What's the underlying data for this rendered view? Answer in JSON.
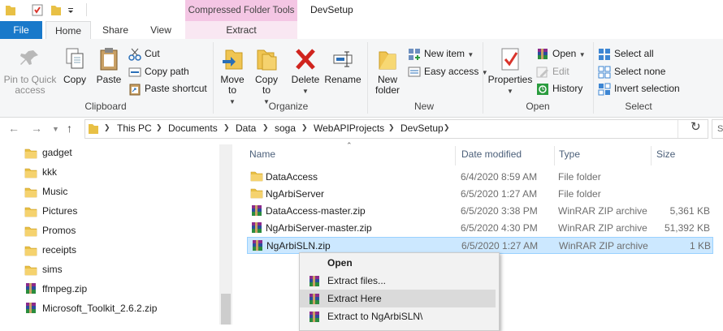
{
  "window": {
    "title": "DevSetup",
    "context_header": "Compressed Folder Tools"
  },
  "tabs": [
    {
      "label": "File"
    },
    {
      "label": "Home"
    },
    {
      "label": "Share"
    },
    {
      "label": "View"
    },
    {
      "label": "Extract"
    }
  ],
  "ribbon": {
    "clipboard": {
      "pin": "Pin to Quick access",
      "copy": "Copy",
      "paste": "Paste",
      "cut": "Cut",
      "copy_path": "Copy path",
      "paste_shortcut": "Paste shortcut",
      "label": "Clipboard"
    },
    "organize": {
      "move_to": "Move to",
      "copy_to": "Copy to",
      "delete": "Delete",
      "rename": "Rename",
      "label": "Organize"
    },
    "new": {
      "new_folder": "New folder",
      "new_item": "New item",
      "easy_access": "Easy access",
      "label": "New"
    },
    "open": {
      "properties": "Properties",
      "open": "Open",
      "edit": "Edit",
      "history": "History",
      "label": "Open"
    },
    "select": {
      "select_all": "Select all",
      "select_none": "Select none",
      "invert": "Invert selection",
      "label": "Select"
    }
  },
  "address": {
    "crumbs": [
      "This PC",
      "Documents",
      "Data",
      "soga",
      "WebAPIProjects",
      "DevSetup"
    ],
    "search_placeholder": "S"
  },
  "nav_pane": [
    {
      "label": "gadget",
      "icon": "folder-icon"
    },
    {
      "label": "kkk",
      "icon": "folder-icon"
    },
    {
      "label": "Music",
      "icon": "folder-icon"
    },
    {
      "label": "Pictures",
      "icon": "folder-icon"
    },
    {
      "label": "Promos",
      "icon": "folder-icon"
    },
    {
      "label": "receipts",
      "icon": "folder-icon"
    },
    {
      "label": "sims",
      "icon": "folder-icon"
    },
    {
      "label": "ffmpeg.zip",
      "icon": "zip-icon"
    },
    {
      "label": "Microsoft_Toolkit_2.6.2.zip",
      "icon": "zip-icon"
    }
  ],
  "columns": {
    "name": "Name",
    "date": "Date modified",
    "type": "Type",
    "size": "Size"
  },
  "files": [
    {
      "name": "DataAccess",
      "date": "6/4/2020 8:59 AM",
      "type": "File folder",
      "size": "",
      "icon": "folder-icon"
    },
    {
      "name": "NgArbiServer",
      "date": "6/5/2020 1:27 AM",
      "type": "File folder",
      "size": "",
      "icon": "folder-icon"
    },
    {
      "name": "DataAccess-master.zip",
      "date": "6/5/2020 3:38 PM",
      "type": "WinRAR ZIP archive",
      "size": "5,361 KB",
      "icon": "zip-icon"
    },
    {
      "name": "NgArbiServer-master.zip",
      "date": "6/5/2020 4:30 PM",
      "type": "WinRAR ZIP archive",
      "size": "51,392 KB",
      "icon": "zip-icon"
    },
    {
      "name": "NgArbiSLN.zip",
      "date": "6/5/2020 1:27 AM",
      "type": "WinRAR ZIP archive",
      "size": "1 KB",
      "icon": "zip-icon",
      "selected": true
    }
  ],
  "context_menu": [
    {
      "label": "Open",
      "bold": true
    },
    {
      "label": "Extract files...",
      "icon": "winrar-icon"
    },
    {
      "label": "Extract Here",
      "icon": "winrar-icon",
      "highlighted": true
    },
    {
      "label": "Extract to NgArbiSLN\\",
      "icon": "winrar-icon"
    }
  ],
  "colors": {
    "accent": "#1979ca",
    "context_tab": "#f4c6e4",
    "selection": "#cce8ff"
  }
}
